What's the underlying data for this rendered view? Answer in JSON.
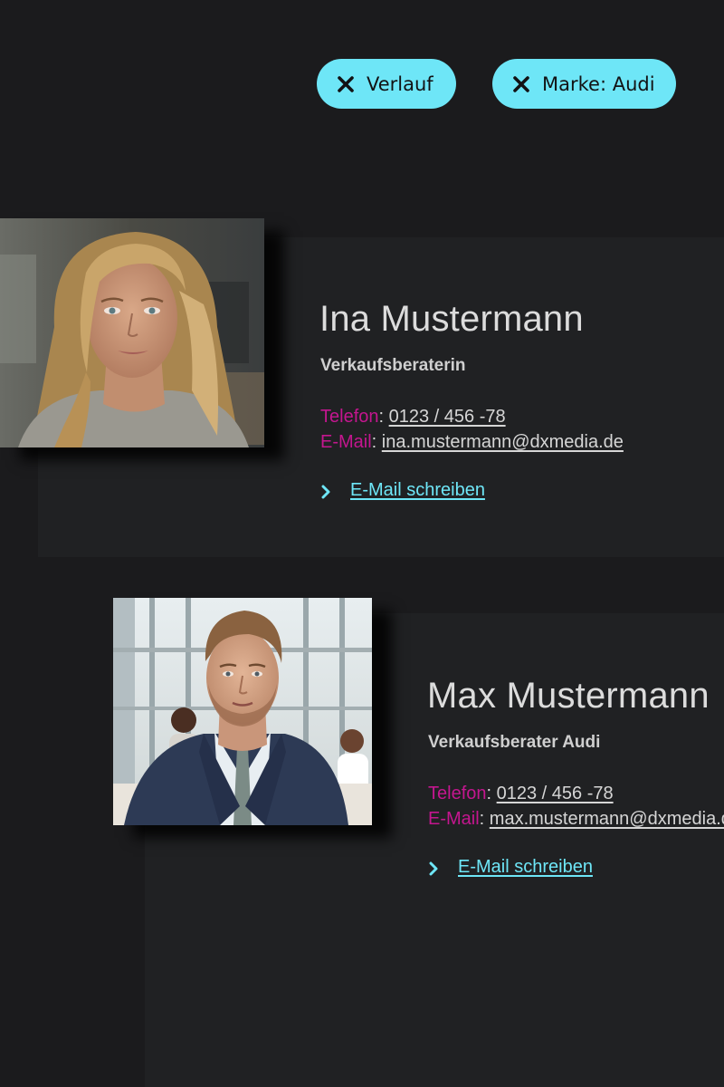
{
  "filters": [
    {
      "label": "Verlauf",
      "icon": "close-icon"
    },
    {
      "label": "Marke: Audi",
      "icon": "close-icon"
    }
  ],
  "contacts": [
    {
      "name": "Ina Mustermann",
      "role": "Verkaufsberaterin",
      "phone_label": "Telefon",
      "phone": "0123 / 456 -78",
      "email_label": "E-Mail",
      "email": "ina.mustermann@dxmedia.de",
      "action_label": "E-Mail schreiben"
    },
    {
      "name": "Max Mustermann",
      "role": "Verkaufsberater Audi",
      "phone_label": "Telefon",
      "phone": "0123 / 456 -78",
      "email_label": "E-Mail",
      "email": "max.mustermann@dxmedia.de",
      "action_label": "E-Mail schreiben"
    }
  ],
  "colors": {
    "background": "#1b1b1d",
    "card": "#202123",
    "accent": "#6ee6f7",
    "label": "#c4168f"
  }
}
